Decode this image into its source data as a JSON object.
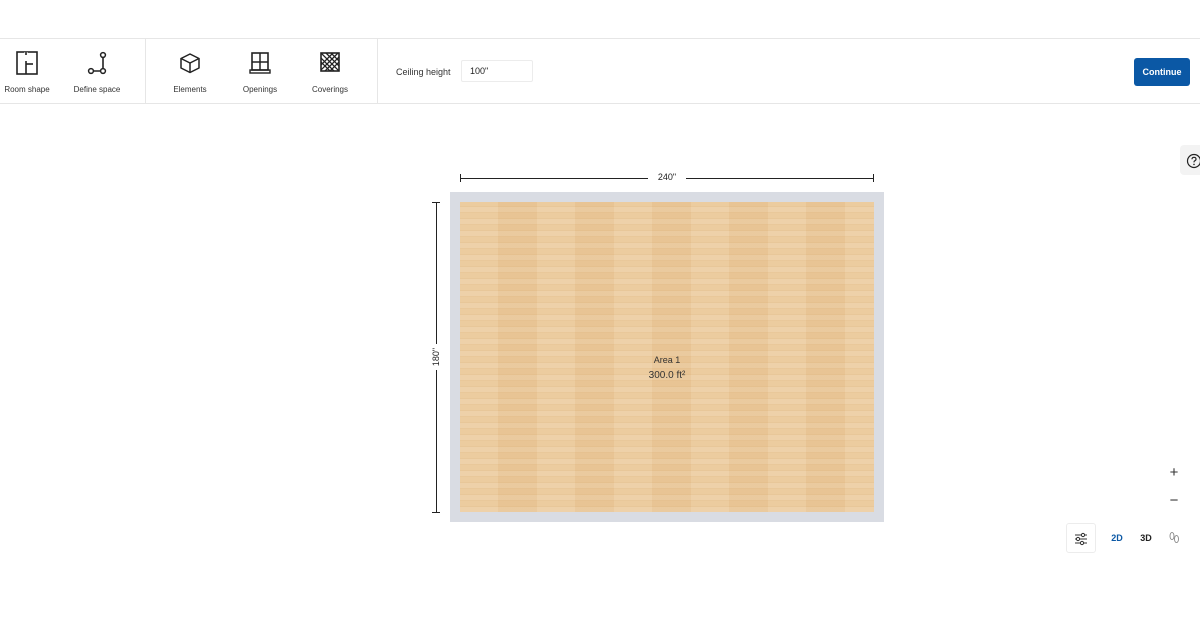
{
  "toolbar": {
    "room_shape": "Room shape",
    "define_space": "Define space",
    "elements": "Elements",
    "openings": "Openings",
    "coverings": "Coverings",
    "ceiling_height_label": "Ceiling height",
    "ceiling_height_value": "100\"",
    "continue_label": "Continue"
  },
  "room": {
    "width_label": "240\"",
    "height_label": "180\"",
    "area_name": "Area 1",
    "area_size": "300.0 ft²",
    "floor_color": "#ebc898",
    "wall_color": "#d9dce3"
  },
  "controls": {
    "zoom_in": "+",
    "zoom_out": "−",
    "view_2d": "2D",
    "view_3d": "3D",
    "icons": [
      "question-icon",
      "sliders-icon",
      "footprints-icon"
    ]
  },
  "colors": {
    "accent": "#0b58a5"
  }
}
